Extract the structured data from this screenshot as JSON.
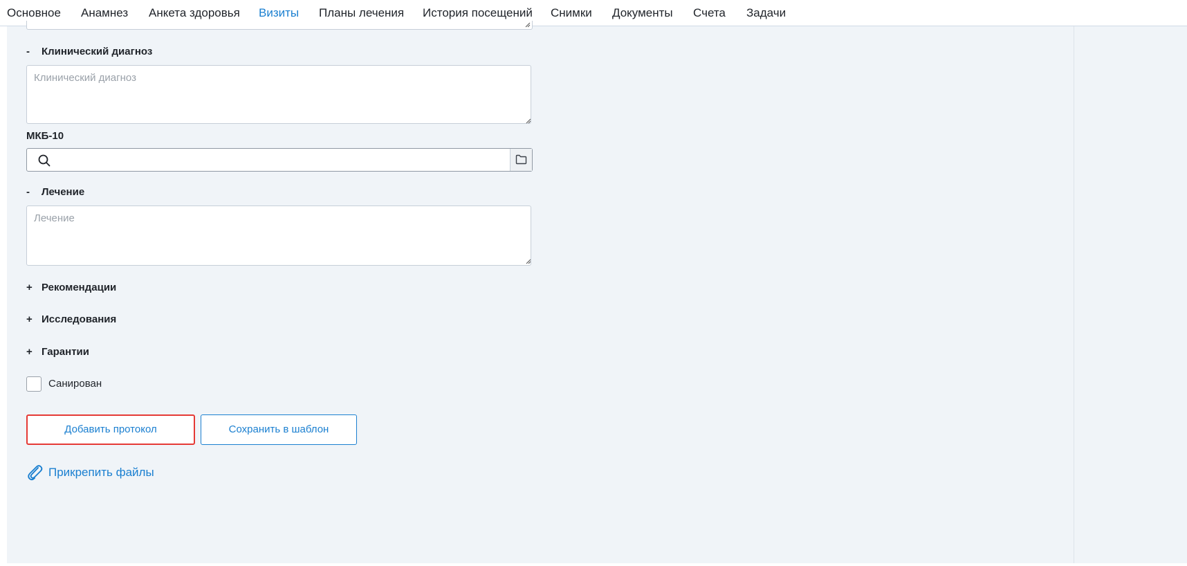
{
  "tabs": [
    {
      "label": "Основное"
    },
    {
      "label": "Анамнез"
    },
    {
      "label": "Анкета здоровья"
    },
    {
      "label": "Визиты"
    },
    {
      "label": "Планы лечения"
    },
    {
      "label": "История посещений"
    },
    {
      "label": "Снимки"
    },
    {
      "label": "Документы"
    },
    {
      "label": "Счета"
    },
    {
      "label": "Задачи"
    }
  ],
  "active_tab": "Визиты",
  "sections": {
    "diagnosis": {
      "sign": "-",
      "title": "Клинический диагноз",
      "placeholder": "Клинический диагноз",
      "value": ""
    },
    "icd": {
      "label": "МКБ-10",
      "value": ""
    },
    "treatment": {
      "sign": "-",
      "title": "Лечение",
      "placeholder": "Лечение",
      "value": ""
    },
    "recommendations": {
      "sign": "+",
      "title": "Рекомендации"
    },
    "research": {
      "sign": "+",
      "title": "Исследования"
    },
    "guarantees": {
      "sign": "+",
      "title": "Гарантии"
    }
  },
  "sanitized": {
    "label": "Санирован",
    "checked": false
  },
  "buttons": {
    "add_protocol": "Добавить протокол",
    "save_template": "Сохранить в шаблон"
  },
  "attach_label": "Прикрепить файлы",
  "colors": {
    "accent": "#1a7fd0",
    "panel_bg": "#f0f4f8",
    "highlight_border": "#e53935"
  },
  "icons": {
    "search": "search-icon",
    "folder": "folder-icon",
    "attach": "paperclip-icon"
  }
}
